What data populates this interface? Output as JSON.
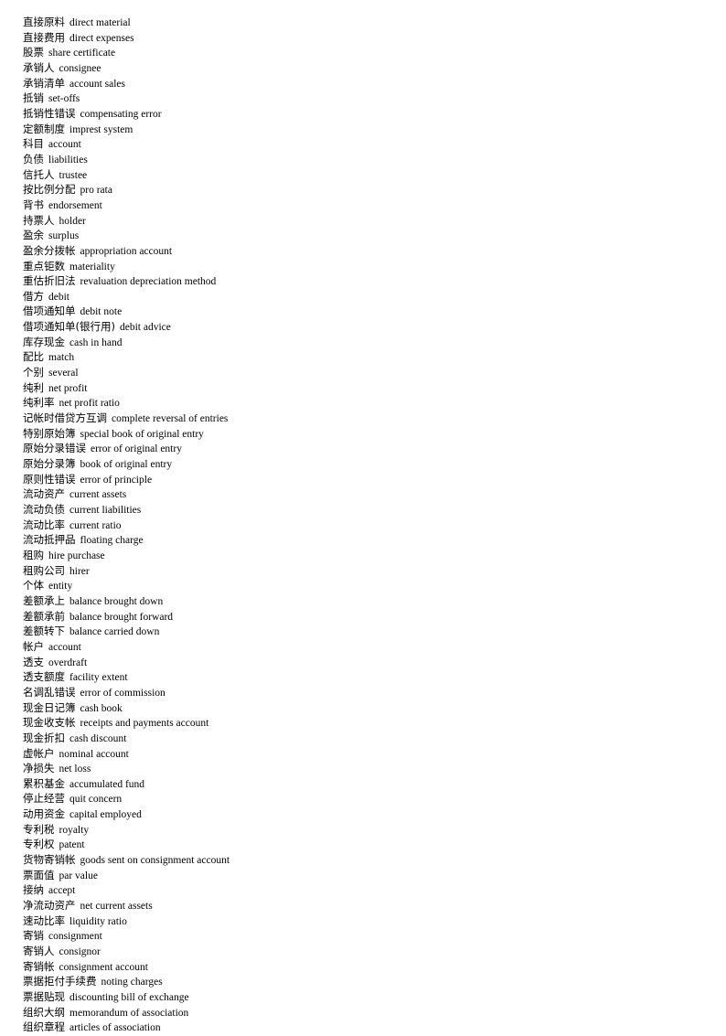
{
  "document": {
    "type": "glossary-list",
    "language_pair": "Chinese-English",
    "subject": "accounting terminology",
    "entry_count": 67
  },
  "entries": [
    {
      "term": "直接原料",
      "gloss": "direct material"
    },
    {
      "term": "直接费用",
      "gloss": "direct expenses"
    },
    {
      "term": "股票",
      "gloss": "share certificate"
    },
    {
      "term": "承销人",
      "gloss": "consignee"
    },
    {
      "term": "承销清单",
      "gloss": "account sales"
    },
    {
      "term": "抵销",
      "gloss": "set-offs"
    },
    {
      "term": "抵销性错误",
      "gloss": "compensating error"
    },
    {
      "term": "定额制度",
      "gloss": "imprest system"
    },
    {
      "term": "科目",
      "gloss": "account"
    },
    {
      "term": "负债",
      "gloss": "liabilities"
    },
    {
      "term": "信托人",
      "gloss": "trustee"
    },
    {
      "term": "按比例分配",
      "gloss": "pro rata"
    },
    {
      "term": "背书",
      "gloss": "endorsement"
    },
    {
      "term": "持票人",
      "gloss": "holder"
    },
    {
      "term": "盈余",
      "gloss": "surplus"
    },
    {
      "term": "盈余分拨帐",
      "gloss": "appropriation account"
    },
    {
      "term": "重点钜数",
      "gloss": "materiality"
    },
    {
      "term": "重估折旧法",
      "gloss": "revaluation depreciation method"
    },
    {
      "term": "借方",
      "gloss": "debit"
    },
    {
      "term": "借项通知单",
      "gloss": "debit note"
    },
    {
      "term": "借项通知单(银行用)",
      "gloss": "debit advice"
    },
    {
      "term": "库存现金",
      "gloss": "cash in hand"
    },
    {
      "term": "配比",
      "gloss": "match"
    },
    {
      "term": "个别",
      "gloss": "several"
    },
    {
      "term": "纯利",
      "gloss": "net profit"
    },
    {
      "term": "纯利率",
      "gloss": "net profit ratio"
    },
    {
      "term": "记帐时借贷方互调",
      "gloss": "complete reversal of entries"
    },
    {
      "term": "特别原始簿",
      "gloss": "special book of original entry"
    },
    {
      "term": "原始分录错误",
      "gloss": "error of original entry"
    },
    {
      "term": "原始分录簿",
      "gloss": "book of original entry"
    },
    {
      "term": "原则性错误",
      "gloss": "error of principle"
    },
    {
      "term": "流动资产",
      "gloss": "current assets"
    },
    {
      "term": "流动负债",
      "gloss": "current liabilities"
    },
    {
      "term": "流动比率",
      "gloss": "current ratio"
    },
    {
      "term": "流动抵押品",
      "gloss": "floating charge"
    },
    {
      "term": "租购",
      "gloss": "hire purchase"
    },
    {
      "term": "租购公司",
      "gloss": "hirer"
    },
    {
      "term": "个体",
      "gloss": "entity"
    },
    {
      "term": "差额承上",
      "gloss": "balance brought down"
    },
    {
      "term": "差额承前",
      "gloss": "balance brought forward"
    },
    {
      "term": "差额转下",
      "gloss": "balance carried down"
    },
    {
      "term": "帐户",
      "gloss": "account"
    },
    {
      "term": "透支",
      "gloss": "overdraft"
    },
    {
      "term": "透支额度",
      "gloss": "facility extent"
    },
    {
      "term": "名调乱错误",
      "gloss": "error of commission"
    },
    {
      "term": "现金日记簿",
      "gloss": "cash book"
    },
    {
      "term": "现金收支帐",
      "gloss": "receipts and payments account"
    },
    {
      "term": "现金折扣",
      "gloss": "cash discount"
    },
    {
      "term": "虚帐户",
      "gloss": "nominal account"
    },
    {
      "term": "净损失",
      "gloss": "net loss"
    },
    {
      "term": "累积基金",
      "gloss": "accumulated fund"
    },
    {
      "term": "停止经营",
      "gloss": "quit concern"
    },
    {
      "term": "动用资金",
      "gloss": "capital employed"
    },
    {
      "term": "专利税",
      "gloss": "royalty"
    },
    {
      "term": "专利权",
      "gloss": "patent"
    },
    {
      "term": "货物寄销帐",
      "gloss": "goods sent on consignment account"
    },
    {
      "term": "票面值",
      "gloss": "par value"
    },
    {
      "term": "接纳",
      "gloss": "accept"
    },
    {
      "term": "净流动资产",
      "gloss": "net current assets"
    },
    {
      "term": "速动比率",
      "gloss": "liquidity ratio"
    },
    {
      "term": "寄销",
      "gloss": "consignment"
    },
    {
      "term": "寄销人",
      "gloss": "consignor"
    },
    {
      "term": "寄销帐",
      "gloss": "consignment account"
    },
    {
      "term": "票据拒付手续费",
      "gloss": "noting charges"
    },
    {
      "term": "票据贴现",
      "gloss": "discounting bill of exchange"
    },
    {
      "term": "组织大纲",
      "gloss": "memorandum of association"
    },
    {
      "term": "组织章程",
      "gloss": "articles of association"
    }
  ]
}
